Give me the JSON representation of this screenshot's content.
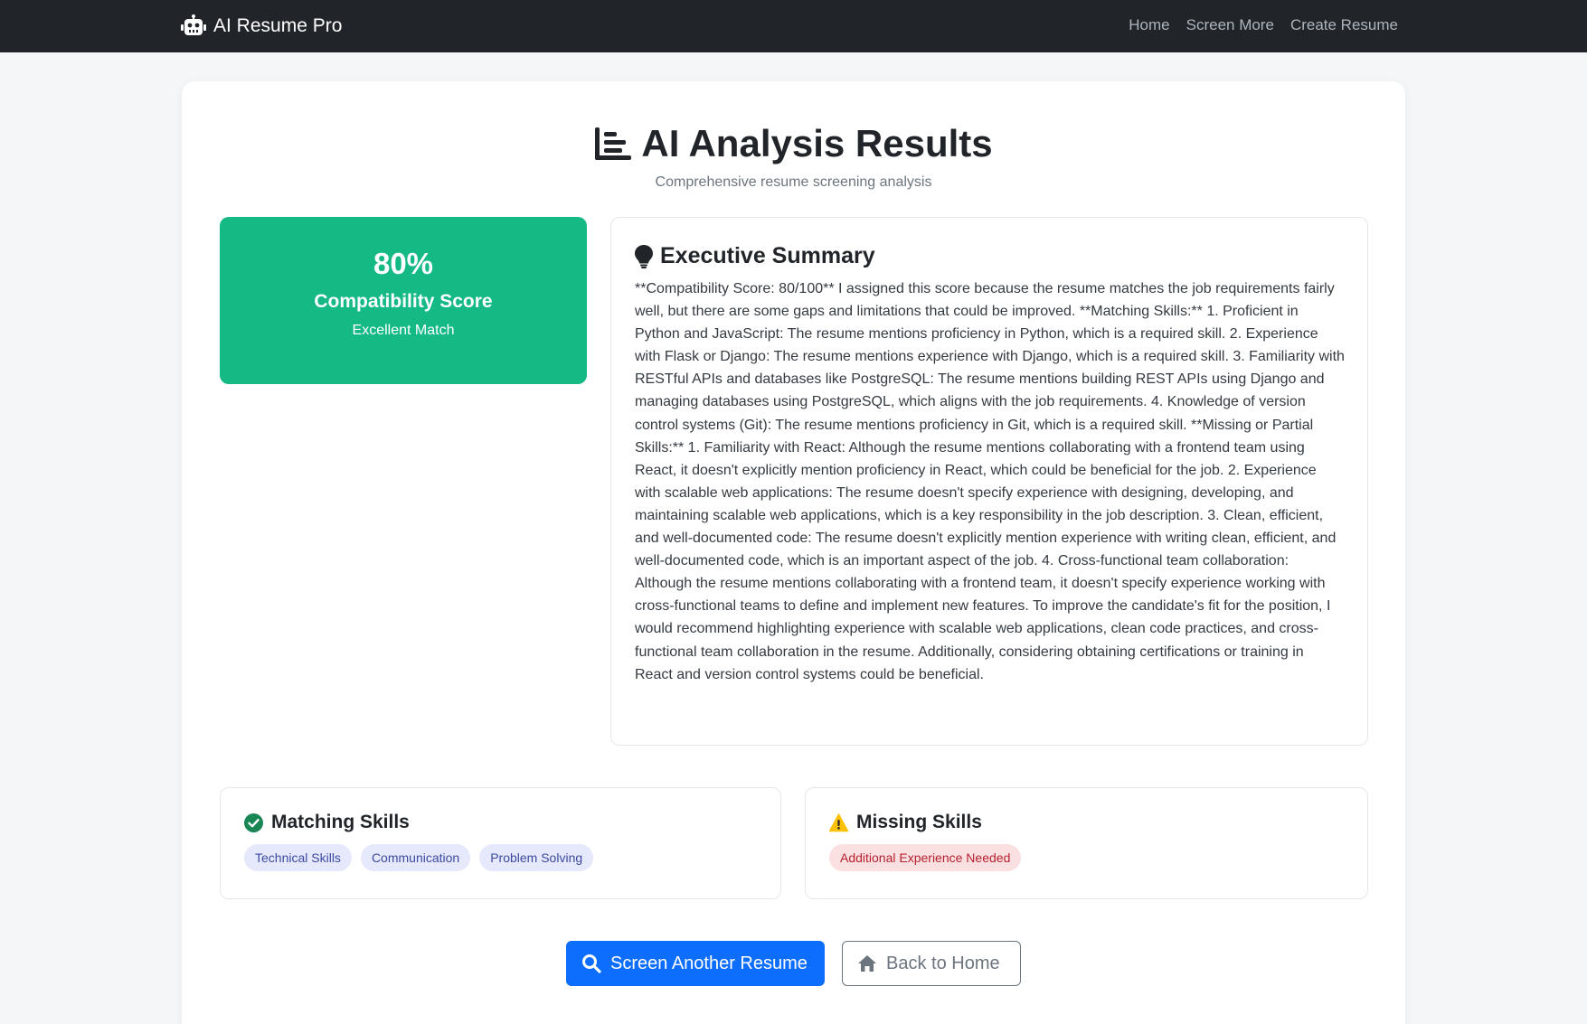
{
  "nav": {
    "brand": "AI Resume Pro",
    "brand_icon": "robot-icon",
    "links": [
      "Home",
      "Screen More",
      "Create Resume"
    ]
  },
  "header": {
    "title": "AI Analysis Results",
    "title_icon": "bar-chart-icon",
    "subtitle": "Comprehensive resume screening analysis"
  },
  "score": {
    "value": "80%",
    "label": "Compatibility Score",
    "description": "Excellent Match",
    "color": "#14b984"
  },
  "summary": {
    "title": "Executive Summary",
    "icon": "lightbulb-icon",
    "text": "**Compatibility Score: 80/100** I assigned this score because the resume matches the job requirements fairly well, but there are some gaps and limitations that could be improved. **Matching Skills:** 1. Proficient in Python and JavaScript: The resume mentions proficiency in Python, which is a required skill. 2. Experience with Flask or Django: The resume mentions experience with Django, which is a required skill. 3. Familiarity with RESTful APIs and databases like PostgreSQL: The resume mentions building REST APIs using Django and managing databases using PostgreSQL, which aligns with the job requirements. 4. Knowledge of version control systems (Git): The resume mentions proficiency in Git, which is a required skill. **Missing or Partial Skills:** 1. Familiarity with React: Although the resume mentions collaborating with a frontend team using React, it doesn't explicitly mention proficiency in React, which could be beneficial for the job. 2. Experience with scalable web applications: The resume doesn't specify experience with designing, developing, and maintaining scalable web applications, which is a key responsibility in the job description. 3. Clean, efficient, and well-documented code: The resume doesn't explicitly mention experience with writing clean, efficient, and well-documented code, which is an important aspect of the job. 4. Cross-functional team collaboration: Although the resume mentions collaborating with a frontend team, it doesn't specify experience working with cross-functional teams to define and implement new features. To improve the candidate's fit for the position, I would recommend highlighting experience with scalable web applications, clean code practices, and cross-functional team collaboration in the resume. Additionally, considering obtaining certifications or training in React and version control systems could be beneficial."
  },
  "matching": {
    "title": "Matching Skills",
    "icon": "check-circle-icon",
    "icon_color": "#198754",
    "tags": [
      "Technical Skills",
      "Communication",
      "Problem Solving"
    ]
  },
  "missing": {
    "title": "Missing Skills",
    "icon": "warning-icon",
    "icon_color": "#ffc107",
    "tags": [
      "Additional Experience Needed"
    ]
  },
  "actions": {
    "primary": "Screen Another Resume",
    "primary_icon": "search-icon",
    "secondary": "Back to Home",
    "secondary_icon": "home-icon"
  }
}
